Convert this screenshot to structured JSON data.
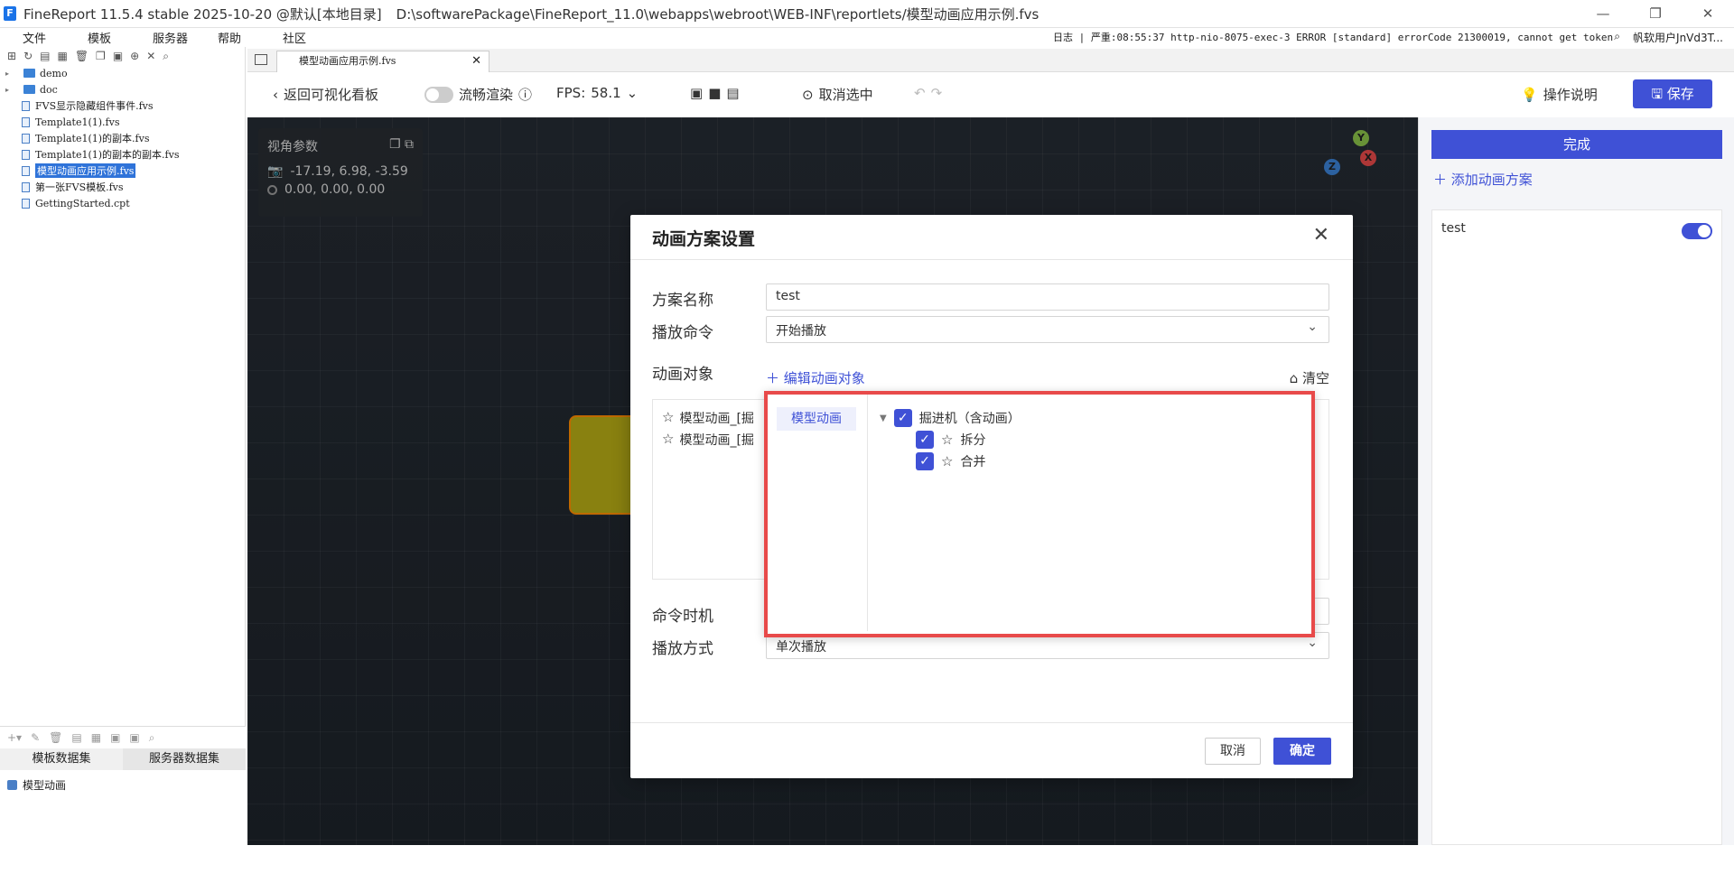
{
  "window": {
    "app_title": "FineReport 11.5.4 stable 2025-10-20 @默认[本地目录]",
    "path": "D:\\softwarePackage\\FineReport_11.0\\webapps\\webroot\\WEB-INF\\reportlets/模型动画应用示例.fvs",
    "controls": [
      "—",
      "❐",
      "✕"
    ]
  },
  "menu": {
    "items": [
      "文件",
      "模板",
      "服务器",
      "帮助",
      "社区"
    ],
    "log_line": "日志 | 严重:08:55:37 http-nio-8075-exec-3 ERROR [standard] errorCode 21300019, cannot get token",
    "user": "帆软用户JnVd3T..."
  },
  "tree": {
    "items": [
      {
        "label": "demo",
        "type": "folder"
      },
      {
        "label": "doc",
        "type": "folder"
      },
      {
        "label": "FVS显示隐藏组件事件.fvs",
        "type": "file"
      },
      {
        "label": "Template1(1).fvs",
        "type": "file"
      },
      {
        "label": "Template1(1)的副本.fvs",
        "type": "file"
      },
      {
        "label": "Template1(1)的副本的副本.fvs",
        "type": "file"
      },
      {
        "label": "模型动画应用示例.fvs",
        "type": "file",
        "selected": true
      },
      {
        "label": "第一张FVS模板.fvs",
        "type": "file"
      },
      {
        "label": "GettingStarted.cpt",
        "type": "file"
      }
    ]
  },
  "datasets": {
    "tabs": [
      "模板数据集",
      "服务器数据集"
    ],
    "item": "模型动画"
  },
  "doc_tab": {
    "label": "模型动画应用示例.fvs"
  },
  "editor": {
    "back": "返回可视化看板",
    "smooth": "流畅渲染",
    "fps_label": "FPS:",
    "fps_value": "58.1",
    "deselect": "取消选中",
    "help": "操作说明",
    "save": "保存"
  },
  "view_panel": {
    "title": "视角参数",
    "camera": "-17.19, 6.98, -3.59",
    "target": "0.00, 0.00, 0.00"
  },
  "gizmo": {
    "y": "Y",
    "x": "X",
    "z": "Z"
  },
  "right_panel": {
    "done": "完成",
    "add": "添加动画方案",
    "plan_name": "test",
    "plan_enabled": true
  },
  "modal": {
    "title": "动画方案设置",
    "name_label": "方案名称",
    "name_value": "test",
    "cmd_label": "播放命令",
    "cmd_value": "开始播放",
    "obj_label": "动画对象",
    "edit_objects": "编辑动画对象",
    "clear": "清空",
    "objects": [
      "模型动画_[掘",
      "模型动画_[掘"
    ],
    "timing_label": "命令时机",
    "mode_label": "播放方式",
    "mode_value": "单次播放",
    "cancel": "取消",
    "ok": "确定"
  },
  "popup": {
    "category": "模型动画",
    "root": "掘进机（含动画）",
    "children": [
      "拆分",
      "合并"
    ]
  },
  "colors": {
    "accent": "#3f51d6",
    "highlight": "#e84a4a"
  }
}
